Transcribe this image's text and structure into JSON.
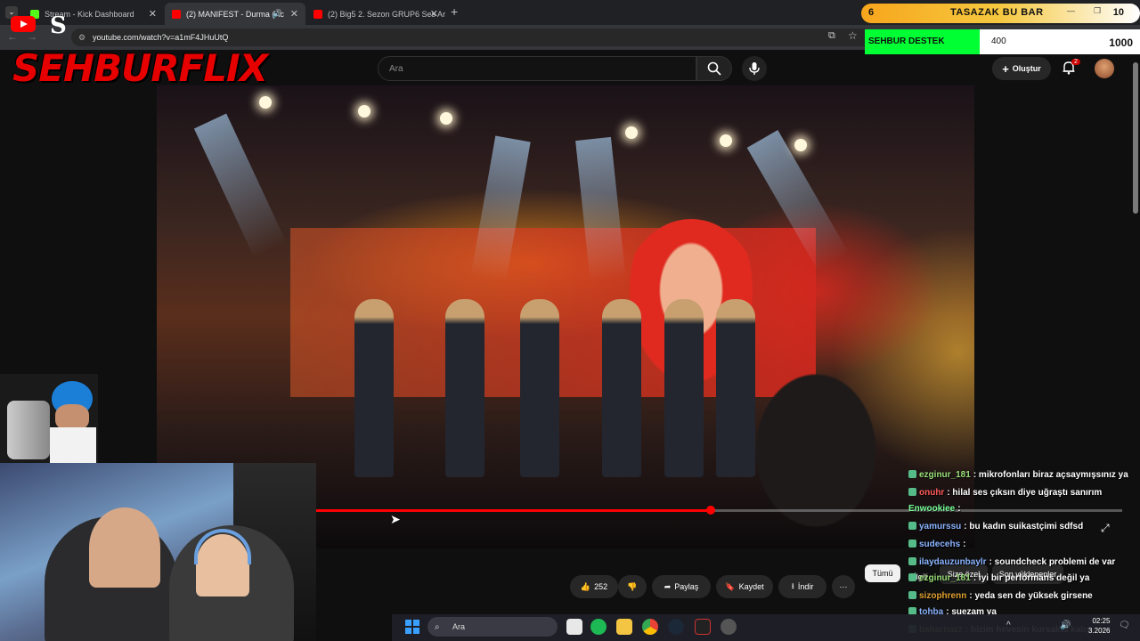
{
  "browser": {
    "tabs": [
      {
        "title": "Stream - Kick Dashboard",
        "fav_color": "#53fc18"
      },
      {
        "title": "(2) MANIFEST - Durma (Ac",
        "fav_color": "#ff0000"
      },
      {
        "title": "(2) Big5 2. Sezon GRUP6 Ses Ar",
        "fav_color": "#ff0000"
      }
    ],
    "new_tab": "+",
    "url": "youtube.com/watch?v=a1mF4JHuUtQ"
  },
  "overlay": {
    "logo": "SEHBURFLIX",
    "tasbar": {
      "left": "6",
      "label": "TASAZAK BU BAR",
      "right": "10"
    },
    "destek": {
      "label": "SEHBUR DESTEK",
      "current": "400",
      "goal": "1000",
      "fill_fraction": 0.4,
      "color": "#00ff33"
    }
  },
  "youtube": {
    "search_placeholder": "Ara",
    "create_label": "Oluştur",
    "notif_count": "2",
    "video_progress": 0.49,
    "actions": {
      "likes": "252",
      "share": "Paylaş",
      "save": "Kaydet",
      "download": "İndir",
      "more": "⋯"
    },
    "filters": {
      "all": "Tümü",
      "related": "İlgili",
      "for_you": "Size özel",
      "recent": "Son yüklenenler"
    }
  },
  "chat": [
    {
      "user": "ezginur_181",
      "color": "#9adf7a",
      "text": ": mikrofonları biraz açsaymışsınız ya"
    },
    {
      "user": "onuhr",
      "color": "#ff5a5a",
      "text": ": hilal ses çıksın diye uğraştı sanırım"
    },
    {
      "user": "Enwookiee",
      "color": "#7aff9a",
      "text": ":"
    },
    {
      "user": "yamurssu",
      "color": "#8ab4ff",
      "text": ": bu kadın suikastçimi sdfsd"
    },
    {
      "user": "sudecehs",
      "color": "#8ab4ff",
      "text": ":"
    },
    {
      "user": "ilaydauzunbaylr",
      "color": "#8ab4ff",
      "text": ": soundcheck problemi de var"
    },
    {
      "user": "ezginur_181",
      "color": "#9adf7a",
      "text": ": iyi bir performans değil ya"
    },
    {
      "user": "sizophrenn",
      "color": "#e0a030",
      "text": ": yeda sen de yüksek girsene"
    },
    {
      "user": "tohba",
      "color": "#8ab4ff",
      "text": ": suezam ya"
    },
    {
      "user": "baharnazz",
      "color": "#9adf7a",
      "text": ": bizim hevesin kursakta kalış"
    }
  ],
  "taskbar": {
    "search": "Ara",
    "time": "02:25",
    "date": "3.2026"
  }
}
